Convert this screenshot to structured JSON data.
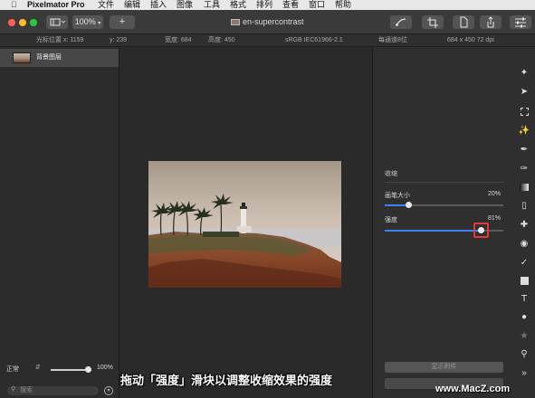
{
  "menubar": {
    "app_name": "Pixelmator Pro",
    "items": [
      "文件",
      "编辑",
      "插入",
      "图像",
      "工具",
      "格式",
      "排列",
      "查看",
      "窗口",
      "帮助"
    ]
  },
  "toolbar": {
    "zoom_value": "100%",
    "add_label": "+",
    "document_title": "en-supercontrast"
  },
  "infobar": {
    "cursor_label": "光标位置 x: 1159",
    "cursor_y": "y: 239",
    "width_label": "宽度: 684",
    "height_label": "高度: 450",
    "color_profile": "sRGB IEC61966-2.1",
    "bit_depth": "每通道8位",
    "dimensions": "684 x 450 72 dpi"
  },
  "layers": {
    "layer_name": "背景图层",
    "blend_mode": "正常",
    "opacity": "100%",
    "opacity_level": 1.0,
    "search_placeholder": "搜索"
  },
  "inspector": {
    "tool_title": "收缩",
    "brush_size_label": "画笔大小",
    "brush_size_value": "20%",
    "brush_size_level": 0.2,
    "strength_label": "强度",
    "strength_value": "81%",
    "strength_level": 0.81,
    "show_options_button": "显示附件"
  },
  "tools": [
    "style-tool-icon",
    "arrow-select-icon",
    "rect-select-icon",
    "magic-select-icon",
    "color-picker-icon",
    "paint-brush-icon",
    "gradient-icon",
    "eraser-icon",
    "retouch-icon",
    "distort-icon",
    "pen-icon",
    "shape-icon",
    "text-icon",
    "color-adjust-icon",
    "effects-icon",
    "zoom-icon",
    "more-tools-icon"
  ],
  "caption": "拖动「强度」滑块以调整收缩效果的强度",
  "watermark": "www.MacZ.com",
  "colors": {
    "accent": "#3b82f6",
    "highlight_box": "#e53935"
  }
}
